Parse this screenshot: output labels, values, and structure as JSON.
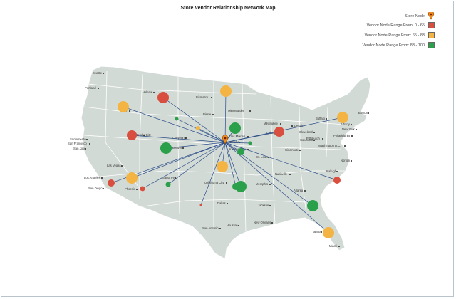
{
  "title": "Store Vendor Relationship Network Map",
  "legend": {
    "store": "Store Node",
    "ranges": [
      {
        "label": "Vendor Node Range From: 0 - 65",
        "color": "#d94f3f"
      },
      {
        "label": "Vendor Node Range From: 65 - 83",
        "color": "#f3b443"
      },
      {
        "label": "Vendor Node Range From: 83 - 100",
        "color": "#2aa04a"
      }
    ]
  },
  "colors": {
    "land": "#d2dad5",
    "border": "#ffffff",
    "link": "#2c4d8a",
    "store_pin": "#f28c1c"
  },
  "cities": [
    "Seattle",
    "Portland",
    "Helena",
    "Bismarck",
    "Pierre",
    "Minneapolis",
    "Boise",
    "Milwaukee",
    "Detroit",
    "Buffalo",
    "Boston",
    "Albany",
    "New York",
    "Philadelphia",
    "Cleveland",
    "Pittsburgh",
    "Washington D.C.",
    "Chicago",
    "Des Moines",
    "Salt Lake City",
    "Cheyenne",
    "Denver",
    "Omaha",
    "Kansas City",
    "Columbus",
    "Cincinnati",
    "St. Louis",
    "Norfolk",
    "Sacramento",
    "San Francisco",
    "San Jose",
    "Las Vegas",
    "Santa Fe",
    "Nashville",
    "Raleigh",
    "Los Angeles",
    "San Diego",
    "Phoenix",
    "Oklahoma City",
    "Memphis",
    "Atlanta",
    "Dallas",
    "Jackson",
    "San Antonio",
    "Houston",
    "New Orleans",
    "Tampa",
    "Miami"
  ]
}
